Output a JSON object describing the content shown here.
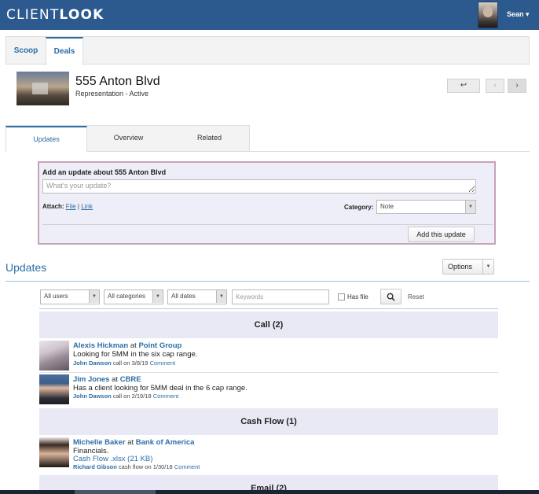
{
  "header": {
    "logo_light": "CLIENT",
    "logo_bold": "LOOK",
    "user_name": "Sean ▾"
  },
  "nav_tabs": [
    {
      "label": "Scoop"
    },
    {
      "label": "Deals",
      "active": true
    }
  ],
  "deal": {
    "title": "555 Anton Blvd",
    "subtitle": "Representation - Active",
    "pager": {
      "back": "↩",
      "prev": "‹",
      "next": "›"
    }
  },
  "section_tabs": [
    {
      "label": "Updates",
      "active": true
    },
    {
      "label": "Overview"
    },
    {
      "label": "Related"
    }
  ],
  "update_form": {
    "title": "Add an update about 555 Anton Blvd",
    "placeholder": "What's your update?",
    "attach_label": "Attach:",
    "attach_file": "File",
    "attach_sep": "|",
    "attach_link": "Link",
    "category_label": "Category:",
    "category_value": "Note",
    "submit_label": "Add this update"
  },
  "updates": {
    "heading": "Updates",
    "options_label": "Options",
    "filters": {
      "users": "All users",
      "categories": "All categories",
      "dates": "All dates",
      "keywords_placeholder": "Keywords",
      "has_file_label": "Has file",
      "reset_label": "Reset"
    },
    "groups": [
      {
        "label": "Call (2)"
      },
      {
        "label": "Cash Flow (1)"
      },
      {
        "label": "Email (2)"
      }
    ],
    "items": [
      {
        "person": "Alexis Hickman",
        "at": "at",
        "company": "Point Group",
        "text": "Looking for 5MM in the six cap range.",
        "author": "John Dawson",
        "meta": " call on 3/8/19 ",
        "comment": "Comment"
      },
      {
        "person": "Jim Jones",
        "at": "at",
        "company": "CBRE",
        "text": "Has a client looking for 5MM deal in the 6 cap range.",
        "author": "John Dawson",
        "meta": " call on 2/19/18 ",
        "comment": "Comment"
      },
      {
        "person": "Michelle Baker",
        "at": "at",
        "company": "Bank of America",
        "text": "Financials.",
        "file": "Cash Flow .xlsx (21 KB)",
        "author": "Richard Gibson",
        "meta": " cash flow on 1/30/18 ",
        "comment": "Comment"
      }
    ]
  },
  "colors": {
    "brand_blue": "#2c5a8e",
    "link_blue": "#2c6ea6",
    "group_bg": "#e9e9f5",
    "form_border": "#c8a2b7"
  },
  "icons": {
    "search": "search-icon",
    "dropdown": "chevron-down-icon",
    "back": "reply-icon",
    "prev": "chevron-left-icon",
    "next": "chevron-right-icon"
  }
}
